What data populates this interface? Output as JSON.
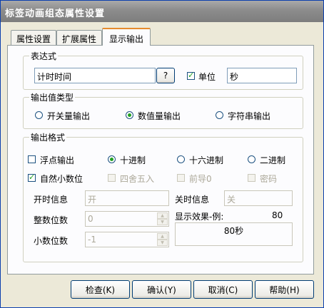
{
  "window": {
    "title": "标签动画组态属性设置"
  },
  "tabs": [
    {
      "label": "属性设置",
      "active": false
    },
    {
      "label": "扩展属性",
      "active": false
    },
    {
      "label": "显示输出",
      "active": true
    }
  ],
  "expression": {
    "group_label": "表达式",
    "value": "计时时间",
    "browse_label": "?",
    "unit_checked": true,
    "unit_label": "单位",
    "unit_value": "秒"
  },
  "output_type": {
    "group_label": "输出值类型",
    "options": [
      {
        "label": "开关量输出",
        "selected": false
      },
      {
        "label": "数值量输出",
        "selected": true
      },
      {
        "label": "字符串输出",
        "selected": false
      }
    ]
  },
  "output_format": {
    "group_label": "输出格式",
    "float_label": "浮点输出",
    "float_checked": false,
    "radix": [
      {
        "label": "十进制",
        "selected": true
      },
      {
        "label": "十六进制",
        "selected": false
      },
      {
        "label": "二进制",
        "selected": false
      }
    ],
    "natural_decimal_label": "自然小数位",
    "natural_decimal_checked": true,
    "round_label": "四舍五入",
    "leading_zero_label": "前导0",
    "password_label": "密码",
    "on_info_label": "开时信息",
    "on_info_value": "开",
    "off_info_label": "关时信息",
    "off_info_value": "关",
    "int_digits_label": "整数位数",
    "int_digits_value": "0",
    "decimal_digits_label": "小数位数",
    "decimal_digits_value": "-1",
    "preview_label": "显示效果-例:",
    "preview_example": "80",
    "preview_result": "80秒"
  },
  "buttons": {
    "check": "检查(K)",
    "ok": "确认(Y)",
    "cancel": "取消(C)",
    "help": "帮助(H)"
  }
}
